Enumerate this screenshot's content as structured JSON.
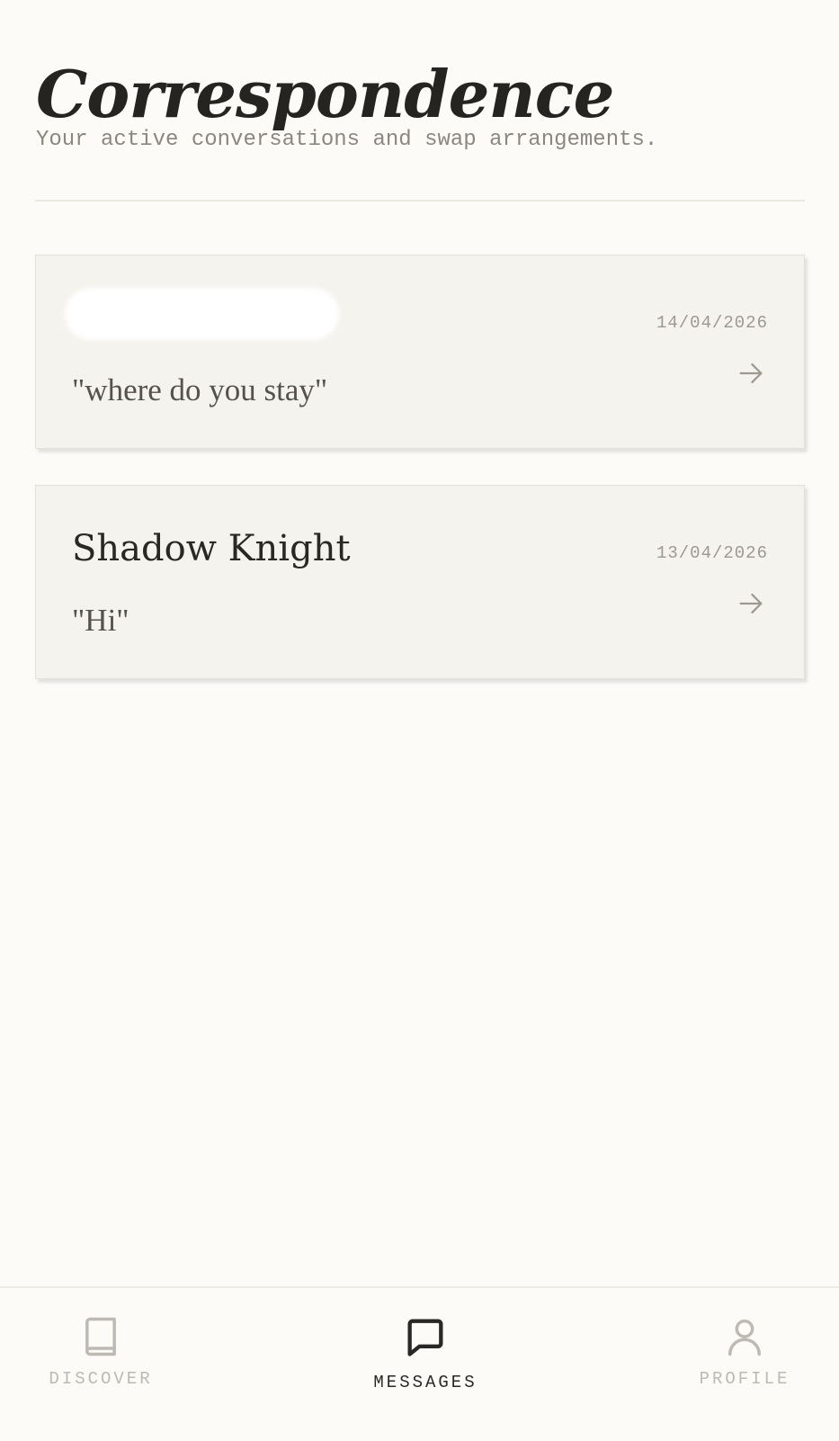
{
  "header": {
    "title": "Correspondence",
    "subtitle": "Your active conversations and swap arrangements."
  },
  "conversations": [
    {
      "name": "",
      "name_redacted": true,
      "last_message": "\"where do you stay\"",
      "date": "14/04/2026",
      "icon": "arrow-right-icon"
    },
    {
      "name": "Shadow Knight",
      "name_redacted": false,
      "last_message": "\"Hi\"",
      "date": "13/04/2026",
      "icon": "arrow-right-icon"
    }
  ],
  "bottom_nav": {
    "items": [
      {
        "label": "DISCOVER",
        "icon": "book-icon",
        "active": false
      },
      {
        "label": "MESSAGES",
        "icon": "message-square-icon",
        "active": true
      },
      {
        "label": "PROFILE",
        "icon": "user-icon",
        "active": false
      }
    ]
  },
  "colors": {
    "background": "#fcfbf7",
    "card": "#f5f3ee",
    "text_primary": "#2a2824",
    "text_muted": "#8b8780",
    "nav_inactive": "#bdbab3"
  }
}
